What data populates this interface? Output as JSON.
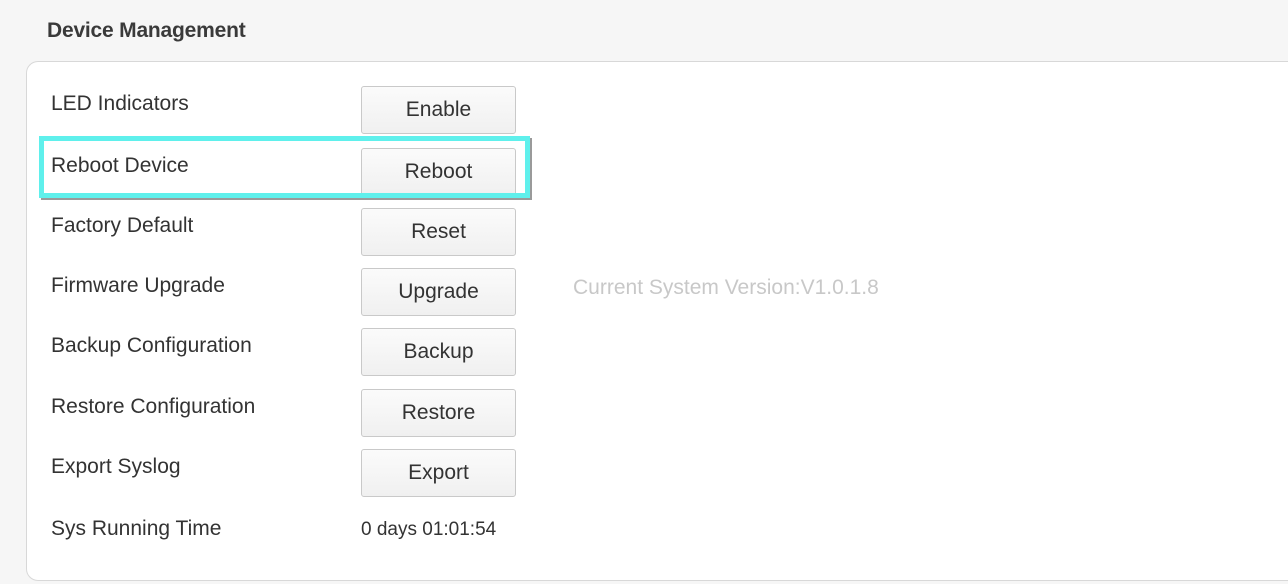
{
  "section": {
    "title": "Device Management"
  },
  "rows": [
    {
      "label": "LED Indicators",
      "button": "Enable"
    },
    {
      "label": "Reboot Device",
      "button": "Reboot"
    },
    {
      "label": "Factory Default",
      "button": "Reset"
    },
    {
      "label": "Firmware Upgrade",
      "button": "Upgrade",
      "info": "Current System Version:V1.0.1.8"
    },
    {
      "label": "Backup Configuration",
      "button": "Backup"
    },
    {
      "label": "Restore Configuration",
      "button": "Restore"
    },
    {
      "label": "Export Syslog",
      "button": "Export"
    },
    {
      "label": "Sys Running Time",
      "value": "0 days 01:01:54"
    }
  ],
  "highlight": {
    "target": "Reboot Device",
    "color": "#5ff0ec"
  },
  "colors": {
    "background": "#f6f6f6",
    "panel": "#ffffff",
    "text": "#333333",
    "info_text": "#c8c8c8"
  }
}
